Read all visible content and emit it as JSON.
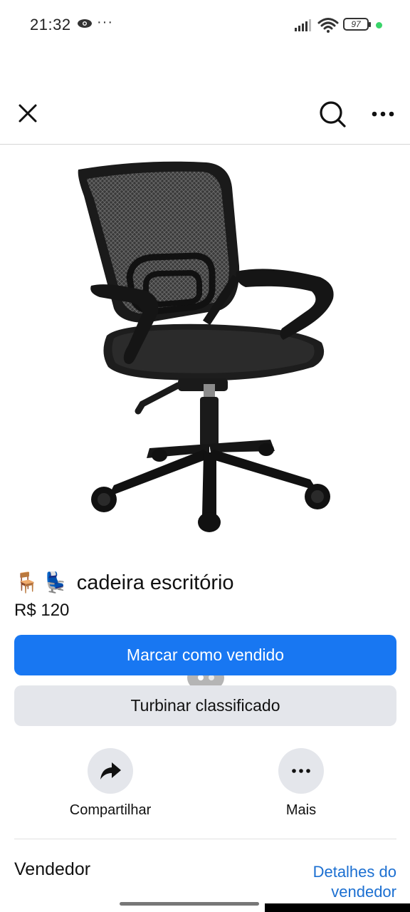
{
  "status_bar": {
    "time": "21:32",
    "more_dots": "···",
    "battery": "97",
    "icons": [
      "eye-icon",
      "signal-icon",
      "wifi-icon",
      "battery-icon"
    ],
    "dot_color": "#3ad46a"
  },
  "nav": {
    "icons": [
      "close-icon",
      "search-icon",
      "more-icon"
    ]
  },
  "photo": {
    "subject": "black mesh office chair",
    "pager_count": 2,
    "pager_active": 1
  },
  "listing": {
    "emoji_1": "🪑",
    "emoji_2": "💺",
    "title": "cadeira escritório",
    "price": "R$ 120"
  },
  "buttons": {
    "mark_sold": "Marcar como vendido",
    "boost": "Turbinar classificado",
    "primary_color": "#1877f2",
    "secondary_color": "#e4e6eb"
  },
  "actions": {
    "share": "Compartilhar",
    "more": "Mais"
  },
  "seller": {
    "heading": "Vendedor",
    "details_link": "Detalhes do vendedor"
  }
}
